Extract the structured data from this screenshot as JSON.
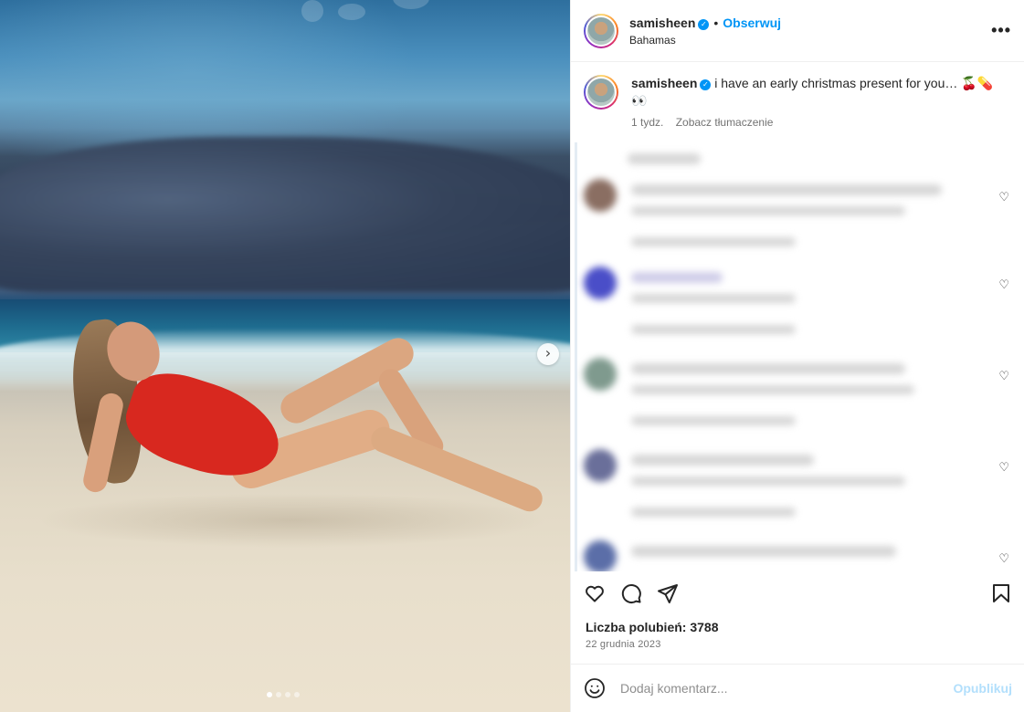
{
  "post": {
    "username": "samisheen",
    "verified_glyph": "✓",
    "separator": "•",
    "follow_label": "Obserwuj",
    "location": "Bahamas",
    "more_glyph": "•••"
  },
  "media": {
    "next_glyph": "›",
    "slide_count": 4,
    "active_slide": 1
  },
  "caption": {
    "username": "samisheen",
    "text": "i have an early christmas present for you… 🍒💊",
    "text_line2": "👀",
    "age": "1 tydz.",
    "translate_label": "Zobacz tłumaczenie"
  },
  "comments": {
    "blurred": true,
    "heart_icon": "heart-outline"
  },
  "actions": {
    "like_icon": "heart-outline",
    "comment_icon": "comment-bubble",
    "share_icon": "paper-plane",
    "save_icon": "bookmark"
  },
  "likes_text": "Liczba polubień: 3788",
  "date_text": "22 grudnia 2023",
  "add_comment": {
    "placeholder": "Dodaj komentarz...",
    "publish_label": "Opublikuj"
  },
  "colors": {
    "accent": "#0095f6",
    "publish_disabled": "#b2dffc",
    "secondary_text": "#737373"
  }
}
